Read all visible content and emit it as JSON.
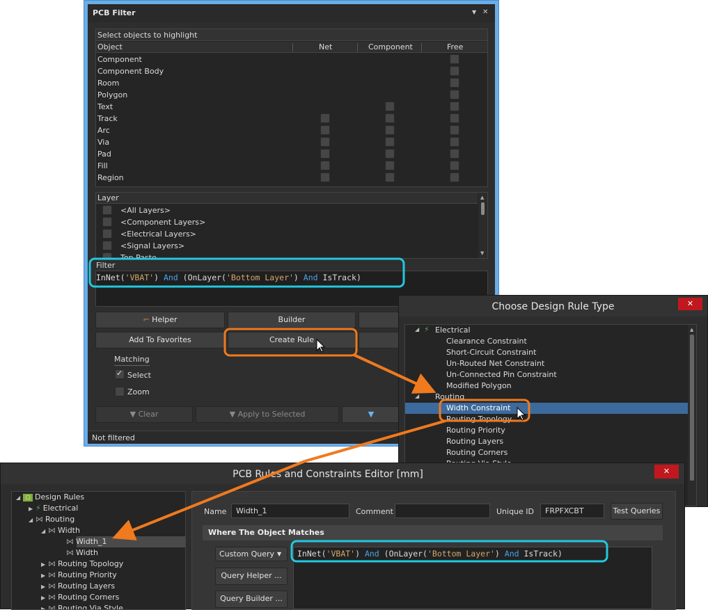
{
  "pcb_filter": {
    "title": "PCB Filter",
    "menu_glyph": "▼",
    "close_glyph": "✕",
    "objects_header": "Select objects to highlight",
    "columns": [
      "Object",
      "Net",
      "Component",
      "Free"
    ],
    "objects": [
      {
        "name": "Component",
        "net": false,
        "component": false,
        "free": true
      },
      {
        "name": "Component Body",
        "net": false,
        "component": false,
        "free": true
      },
      {
        "name": "Room",
        "net": false,
        "component": false,
        "free": true
      },
      {
        "name": "Polygon",
        "net": false,
        "component": false,
        "free": true
      },
      {
        "name": "Text",
        "net": false,
        "component": true,
        "free": true
      },
      {
        "name": "Track",
        "net": true,
        "component": true,
        "free": true
      },
      {
        "name": "Arc",
        "net": true,
        "component": true,
        "free": true
      },
      {
        "name": "Via",
        "net": true,
        "component": true,
        "free": true
      },
      {
        "name": "Pad",
        "net": true,
        "component": true,
        "free": true
      },
      {
        "name": "Fill",
        "net": true,
        "component": true,
        "free": true
      },
      {
        "name": "Region",
        "net": true,
        "component": true,
        "free": true
      }
    ],
    "layer_header": "Layer",
    "layers": [
      "<All Layers>",
      "<Component Layers>",
      "<Electrical Layers>",
      "<Signal Layers>",
      "Top Paste"
    ],
    "filter_label": "Filter",
    "filter_query": [
      {
        "t": "InNet(",
        "c": "plain"
      },
      {
        "t": "'VBAT'",
        "c": "str"
      },
      {
        "t": ") ",
        "c": "plain"
      },
      {
        "t": "And",
        "c": "kw"
      },
      {
        "t": " (OnLayer(",
        "c": "plain"
      },
      {
        "t": "'Bottom Layer'",
        "c": "str"
      },
      {
        "t": ") ",
        "c": "plain"
      },
      {
        "t": "And",
        "c": "kw"
      },
      {
        "t": " IsTrack)",
        "c": "plain"
      }
    ],
    "buttons": {
      "helper": "Helper",
      "builder": "Builder",
      "add_favorites": "Add To Favorites",
      "create_rule": "Create Rule",
      "clear": "Clear",
      "apply_selected": "Apply to Selected"
    },
    "matching_label": "Matching",
    "select_label": "Select",
    "select_checked": true,
    "zoom_label": "Zoom",
    "zoom_checked": false,
    "status": "Not filtered"
  },
  "choose_rule": {
    "title": "Choose Design Rule Type",
    "close_glyph": "✕",
    "electrical": "Electrical",
    "electrical_items": [
      "Clearance Constraint",
      "Short-Circuit Constraint",
      "Un-Routed Net Constraint",
      "Un-Connected Pin Constraint",
      "Modified Polygon"
    ],
    "routing": "Routing",
    "routing_items": [
      "Width Constraint",
      "Routing Topology",
      "Routing Priority",
      "Routing Layers",
      "Routing Corners",
      "Routing Via Style"
    ],
    "selected": "Width Constraint"
  },
  "rules_editor": {
    "title": "PCB Rules and Constraints Editor [mm]",
    "close_glyph": "✕",
    "tree": {
      "root": "Design Rules",
      "electrical": "Electrical",
      "routing": "Routing",
      "width": "Width",
      "width_1": "Width_1",
      "width_child": "Width",
      "others": [
        "Routing Topology",
        "Routing Priority",
        "Routing Layers",
        "Routing Corners",
        "Routing Via Style"
      ]
    },
    "name_label": "Name",
    "name_value": "Width_1",
    "comment_label": "Comment",
    "comment_value": "",
    "unique_id_label": "Unique ID",
    "unique_id_value": "FRPFXCBT",
    "test_queries": "Test Queries",
    "where_header": "Where The Object Matches",
    "query_mode": "Custom Query",
    "query_helper": "Query Helper ...",
    "query_builder": "Query Builder ..."
  },
  "colors": {
    "highlight_cyan": "#22c8e0",
    "highlight_orange": "#f07a1e",
    "selection_blue": "#3d6a9c",
    "panel_dark": "#2d2d2d",
    "close_red": "#c0181e"
  }
}
